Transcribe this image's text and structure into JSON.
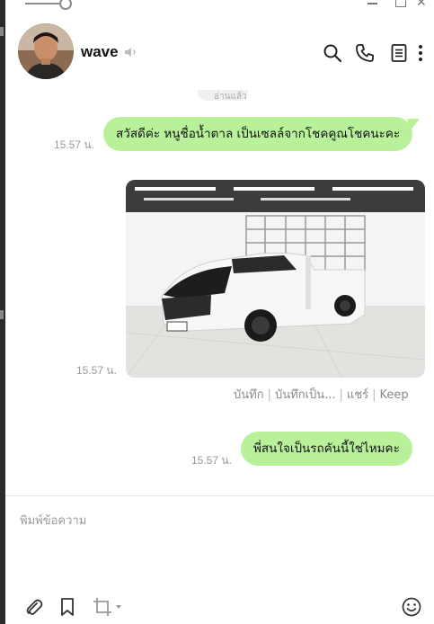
{
  "contact": {
    "name": "wave"
  },
  "status": {
    "read_label": "อ่านแล้ว"
  },
  "messages": [
    {
      "time": "15.57 น.",
      "text": "สวัสดีค่ะ หนูชื่อน้ำตาล เป็นเซลล์จากโชคคูณโชคนะคะ"
    },
    {
      "time": "15.57 น.",
      "image_alt": "white pickup truck with cargo rack"
    },
    {
      "time": "15.57 น.",
      "text": "พี่สนใจเป็นรถคันนี้ใช่ไหมคะ"
    }
  ],
  "photo_actions": {
    "save": "บันทึก",
    "save_as": "บันทึกเป็น...",
    "share": "แชร์",
    "keep": "Keep"
  },
  "composer": {
    "placeholder": "พิมพ์ข้อความ"
  },
  "colors": {
    "bubble": "#b9f19a",
    "time": "#999999"
  },
  "icons": [
    "search-icon",
    "phone-icon",
    "notes-icon",
    "more-icon",
    "speaker-icon",
    "paperclip-icon",
    "bookmark-icon",
    "crop-icon",
    "emoji-icon"
  ]
}
